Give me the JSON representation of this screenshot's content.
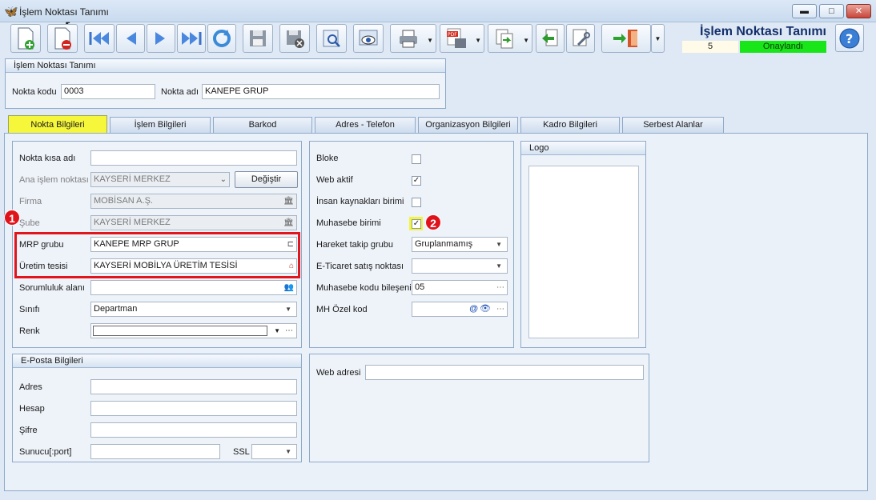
{
  "window": {
    "title": "İşlem Noktası Tanımı",
    "minimize": "▬",
    "maximize": "□",
    "close": "✕"
  },
  "toolbar": {
    "icons": [
      "new-document-icon",
      "delete-document-icon",
      "first-record-icon",
      "previous-record-icon",
      "next-record-icon",
      "last-record-icon",
      "refresh-icon",
      "save-icon",
      "save-close-icon",
      "search-icon",
      "preview-icon",
      "print-icon",
      "pdf-export-icon",
      "transfer-icon",
      "back-icon",
      "tools-icon",
      "exit-icon"
    ]
  },
  "header": {
    "title": "İşlem Noktası Tanımı",
    "number": "5",
    "status": "Onaylandı",
    "status_color": "#19e619",
    "help": "?"
  },
  "point_group": {
    "title": "İşlem Noktası Tanımı",
    "code_label": "Nokta kodu",
    "code_value": "0003",
    "name_label": "Nokta adı",
    "name_value": "KANEPE GRUP"
  },
  "tabs": [
    {
      "label": "Nokta Bilgileri",
      "active": true
    },
    {
      "label": "İşlem Bilgileri"
    },
    {
      "label": "Barkod"
    },
    {
      "label": "Adres - Telefon"
    },
    {
      "label": "Organizasyon Bilgileri"
    },
    {
      "label": "Kadro Bilgileri"
    },
    {
      "label": "Serbest Alanlar"
    }
  ],
  "left_form": {
    "short_name_label": "Nokta kısa adı",
    "short_name_value": "",
    "main_point_label": "Ana işlem noktası",
    "main_point_value": "KAYSERİ MERKEZ",
    "change_button": "Değiştir",
    "company_label": "Firma",
    "company_value": "MOBİSAN A.Ş.",
    "branch_label": "Şube",
    "branch_value": "KAYSERİ MERKEZ",
    "mrp_label": "MRP grubu",
    "mrp_value": "KANEPE MRP GRUP",
    "facility_label": "Üretim tesisi",
    "facility_value": "KAYSERİ MOBİLYA ÜRETİM TESİSİ",
    "responsibility_label": "Sorumluluk alanı",
    "responsibility_value": "",
    "class_label": "Sınıfı",
    "class_value": "Departman",
    "color_label": "Renk",
    "color_value": ""
  },
  "right_form": {
    "block_label": "Bloke",
    "block_checked": false,
    "web_active_label": "Web aktif",
    "web_active_checked": true,
    "hr_label": "İnsan kaynakları birimi",
    "hr_checked": false,
    "accounting_label": "Muhasebe birimi",
    "accounting_checked": true,
    "tracking_label": "Hareket takip grubu",
    "tracking_value": "Gruplanmamış",
    "ecommerce_label": "E-Ticaret satış noktası",
    "ecommerce_value": "",
    "acc_code_label": "Muhasebe kodu bileşeni",
    "acc_code_value": "05",
    "mh_label": "MH Özel kod",
    "mh_value": ""
  },
  "logo": {
    "title": "Logo"
  },
  "email_group": {
    "title": "E-Posta Bilgileri",
    "address_label": "Adres",
    "account_label": "Hesap",
    "password_label": "Şifre",
    "server_label": "Sunucu[:port]",
    "ssl_label": "SSL"
  },
  "web": {
    "label": "Web adresi",
    "value": ""
  },
  "annotations": {
    "badge1": "1",
    "badge2": "2",
    "highlight_color": "#e2151c"
  }
}
